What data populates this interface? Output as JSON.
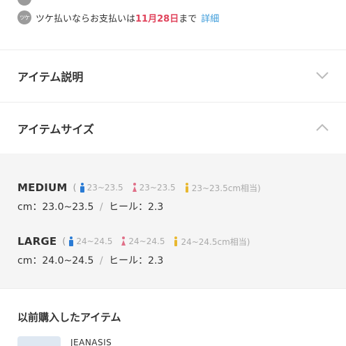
{
  "payment": {
    "tsuke_icon_text": "ツケ",
    "text_before": "ツケ払いならお支払いは",
    "date": "11月28日",
    "text_after": "まで",
    "detail_link": "詳細"
  },
  "accordion": {
    "item_description": {
      "label": "アイテム説明",
      "expanded": false
    },
    "item_size": {
      "label": "アイテムサイズ",
      "expanded": true
    }
  },
  "sizes": [
    {
      "name": "MEDIUM",
      "paren": "(",
      "blue_range": "23~23.5",
      "pink_range": "23~23.5",
      "yellow_range": "23~23.5cm相当)",
      "cm_line": "cm：23.0~23.5",
      "slash": "/",
      "heel_line": "ヒール：2.3"
    },
    {
      "name": "LARGE",
      "paren": "(",
      "blue_range": "24~24.5",
      "pink_range": "24~24.5",
      "yellow_range": "24~24.5cm相当)",
      "cm_line": "cm：24.0~24.5",
      "slash": "/",
      "heel_line": "ヒール：2.3"
    }
  ],
  "previous": {
    "title": "以前購入したアイテム",
    "brand": "JEANASIS"
  },
  "colors": {
    "accent_red": "#e0445c",
    "link_blue": "#3a9ad9",
    "person_blue": "#2a7bd4",
    "person_pink": "#e07088",
    "person_yellow": "#e8b830",
    "panel_bg": "#f5f5f5"
  }
}
